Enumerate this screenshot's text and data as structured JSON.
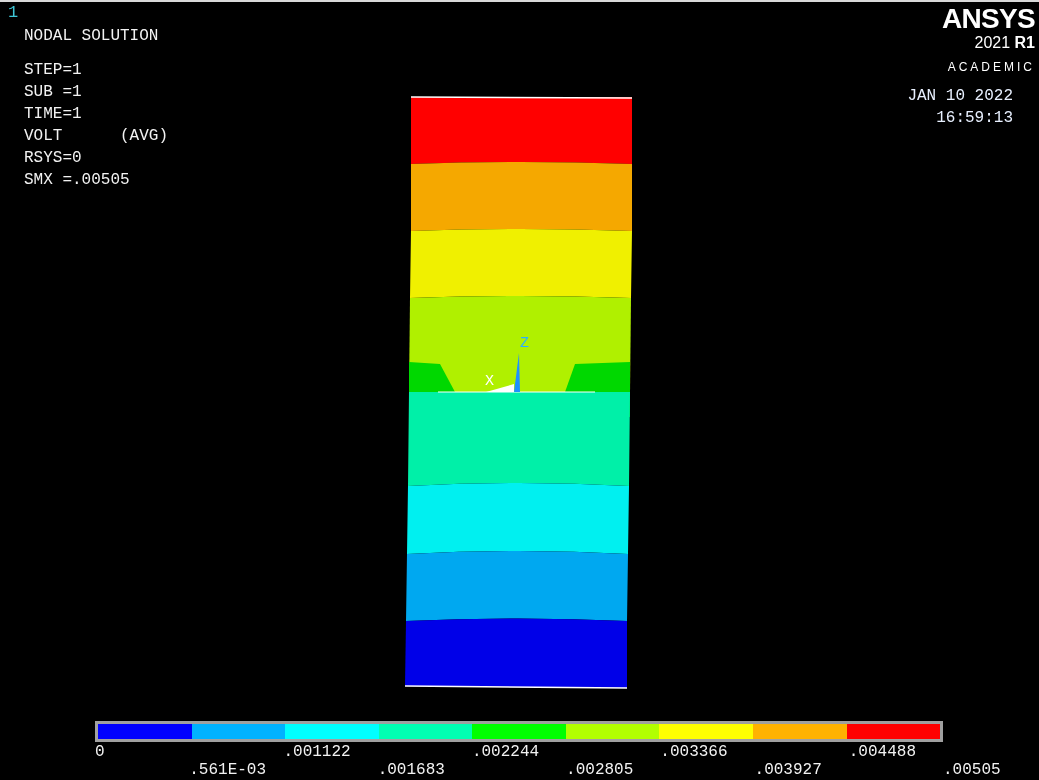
{
  "window_number": "1",
  "title": "NODAL SOLUTION",
  "info_lines": [
    "STEP=1",
    "SUB =1",
    "TIME=1",
    "VOLT      (AVG)",
    "RSYS=0",
    "SMX =.00505"
  ],
  "logo": {
    "brand": "ANSYS",
    "version": "2021",
    "release": "R1",
    "edition": "ACADEMIC"
  },
  "date": "JAN 10 2022",
  "time": "16:59:13",
  "triad": {
    "x_label": "X",
    "z_label": "Z"
  },
  "legend": {
    "bands": [
      {
        "color": "#0000ff"
      },
      {
        "color": "#00b2ff"
      },
      {
        "color": "#00ffff"
      },
      {
        "color": "#00ffb2"
      },
      {
        "color": "#00ff00"
      },
      {
        "color": "#b2ff00"
      },
      {
        "color": "#ffff00"
      },
      {
        "color": "#ffb200"
      },
      {
        "color": "#ff0000"
      }
    ],
    "labels": [
      "0",
      ".561E-03",
      ".001122",
      ".001683",
      ".002244",
      ".002805",
      ".003366",
      ".003927",
      ".004488",
      ".00505"
    ]
  }
}
